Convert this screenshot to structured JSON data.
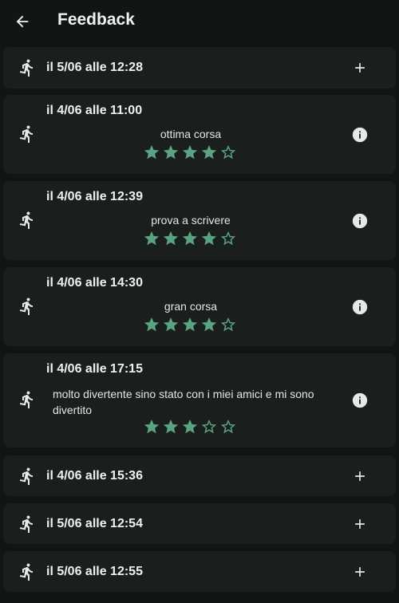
{
  "app_bar": {
    "title": "Feedback",
    "back_icon": "arrow-left-icon"
  },
  "colors": {
    "background": "#111514",
    "card": "#1a1f1e",
    "star": "#5aa382",
    "icon": "#e6e9e8"
  },
  "entries": [
    {
      "date": "il 5/06 alle 12:28",
      "comment": "",
      "rating": null,
      "action": "add"
    },
    {
      "date": "il 4/06 alle 11:00",
      "comment": "ottima corsa",
      "rating": 4,
      "action": "info"
    },
    {
      "date": "il 4/06 alle 12:39",
      "comment": "prova a scrivere",
      "rating": 4,
      "action": "info"
    },
    {
      "date": "il 4/06 alle 14:30",
      "comment": "gran corsa",
      "rating": 4,
      "action": "info"
    },
    {
      "date": "il 4/06 alle 17:15",
      "comment": "molto divertente sino stato con i miei amici e mi sono divertito",
      "rating": 3,
      "action": "info"
    },
    {
      "date": "il 4/06 alle 15:36",
      "comment": "",
      "rating": null,
      "action": "add"
    },
    {
      "date": "il 5/06 alle 12:54",
      "comment": "",
      "rating": null,
      "action": "add"
    },
    {
      "date": "il 5/06 alle 12:55",
      "comment": "",
      "rating": null,
      "action": "add"
    }
  ]
}
